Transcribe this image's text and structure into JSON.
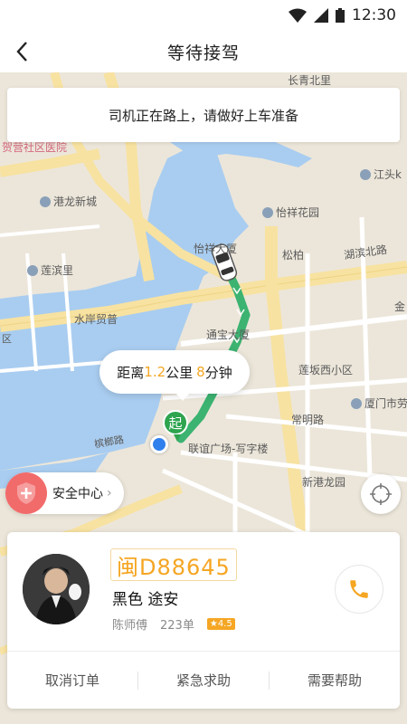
{
  "status_bar": {
    "time": "12:30"
  },
  "nav": {
    "title": "等待接驾"
  },
  "notice": {
    "text": "司机正在路上，请做好上车准备"
  },
  "bubble": {
    "prefix": "距离",
    "distance": "1.2",
    "distance_unit": "公里",
    "minutes": "8",
    "minutes_unit": "分钟"
  },
  "start_marker": {
    "label": "起"
  },
  "safety": {
    "label": "安全中心"
  },
  "map_labels": {
    "hospital": "贺营社区医院",
    "changhe": "长青北里",
    "ganglong": "港龙新城",
    "yixiang": "怡祥花园",
    "lianbin": "莲滨里",
    "yixiangbldg": "怡祥大厦",
    "songbai": "松柏",
    "hubin_north": "湖滨北路",
    "shuian": "水岸贸普",
    "tongbao": "通宝大厦",
    "jinxiang": "金",
    "lianpo": "莲坂西小区",
    "changming": "常明路",
    "xiamen_labor": "厦门市劳",
    "jiangtou": "江头k",
    "lianyi": "联谊广场-写字楼",
    "xingang": "新港龙园",
    "binlu": "槟榔路",
    "district": "区"
  },
  "driver": {
    "plate": "闽D88645",
    "car": "黑色 途安",
    "name": "陈师傅",
    "orders": "223单",
    "rating": "4.5"
  },
  "actions": {
    "cancel": "取消订单",
    "emergency": "紧急求助",
    "help": "需要帮助"
  },
  "colors": {
    "accent": "#f5a623",
    "route": "#3cb371",
    "start": "#2ea44f",
    "safety": "#f26b6b"
  }
}
